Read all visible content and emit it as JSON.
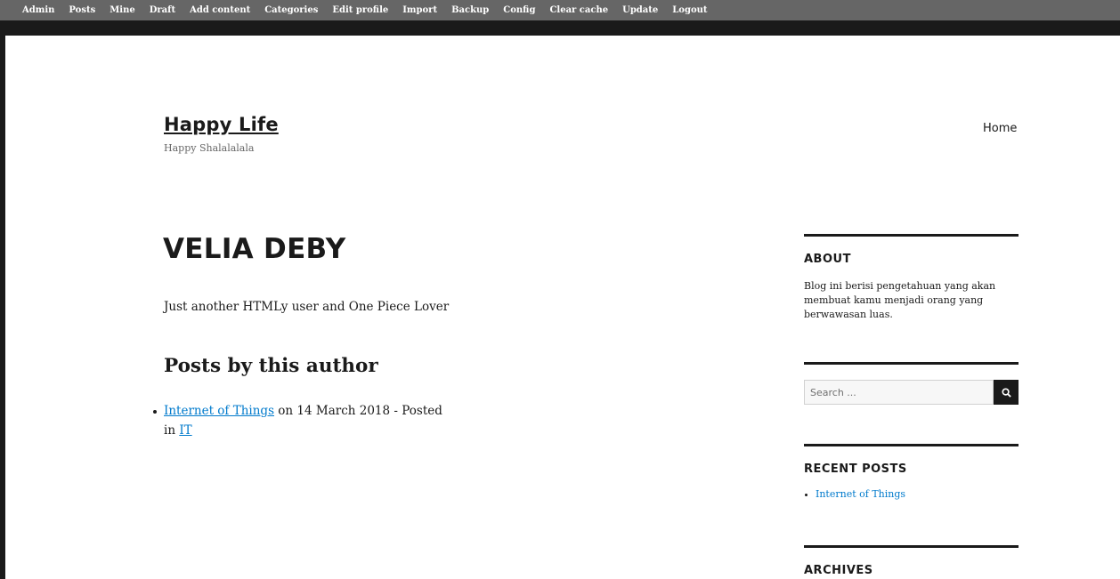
{
  "toolbar": {
    "items": [
      "Admin",
      "Posts",
      "Mine",
      "Draft",
      "Add content",
      "Categories",
      "Edit profile",
      "Import",
      "Backup",
      "Config",
      "Clear cache",
      "Update",
      "Logout"
    ]
  },
  "header": {
    "title": "Happy Life",
    "description": "Happy Shalalalala",
    "nav_home": "Home"
  },
  "main": {
    "author_name": "VELIA DEBY",
    "bio": "Just another HTMLy user and One Piece Lover",
    "posts_heading": "Posts by this author",
    "posts": [
      {
        "title": "Internet of Things",
        "date_text": " on 14 March 2018 - Posted in ",
        "category": "IT"
      }
    ]
  },
  "sidebar": {
    "about_title": "ABOUT",
    "about_text": "Blog ini berisi pengetahuan yang akan membuat kamu menjadi orang yang berwawasan luas.",
    "search_placeholder": "Search ...",
    "search_icon": "search-icon",
    "recent_title": "RECENT POSTS",
    "recent_items": [
      "Internet of Things"
    ],
    "archives_title": "ARCHIVES"
  },
  "colors": {
    "toolbar_bg": "#666666",
    "link": "#007acc",
    "text": "#1a1a1a"
  }
}
